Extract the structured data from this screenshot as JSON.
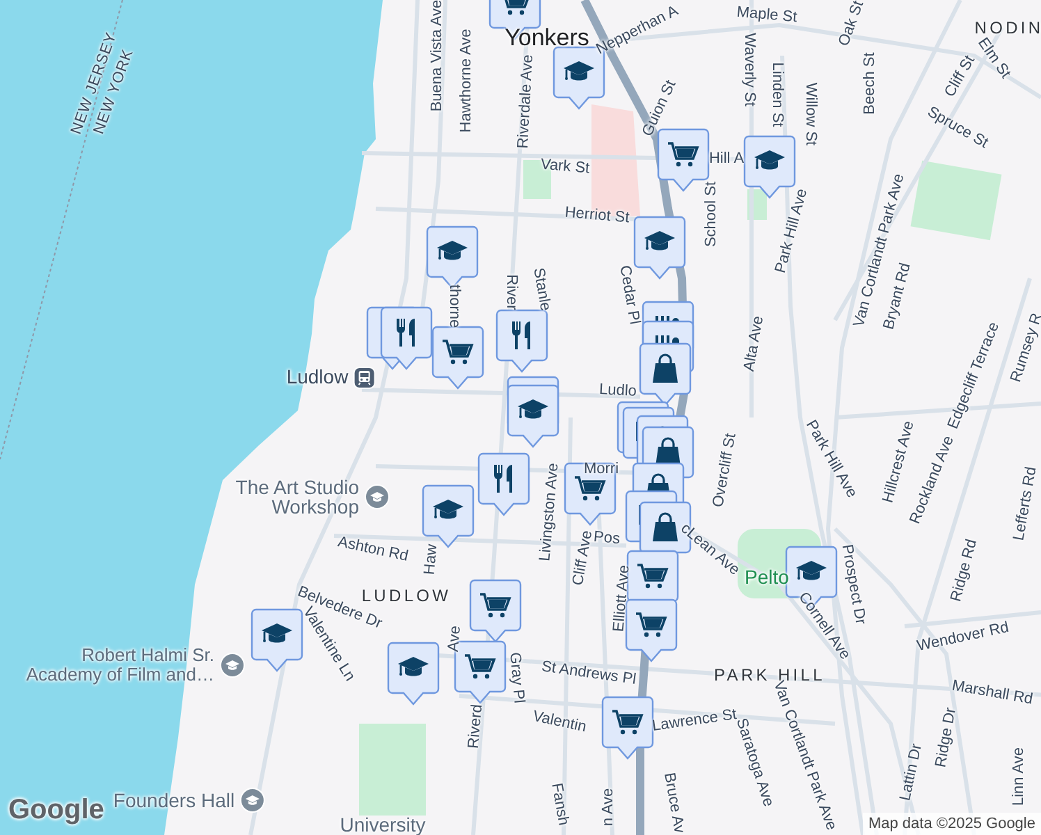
{
  "labels": [
    {
      "text": "NEW JERSEY",
      "kind": "state"
    },
    {
      "text": "NEW YORK",
      "kind": "state"
    },
    {
      "text": "Yonkers",
      "kind": "city"
    },
    {
      "text": "Buena Vista Ave",
      "kind": "street"
    },
    {
      "text": "Hawthorne Ave",
      "kind": "street"
    },
    {
      "text": "Riverdale Ave",
      "kind": "street"
    },
    {
      "text": "Nepperhan A",
      "kind": "street"
    },
    {
      "text": "Maple St",
      "kind": "street"
    },
    {
      "text": "Oak St",
      "kind": "street"
    },
    {
      "text": "NODIN",
      "kind": "neighborhood"
    },
    {
      "text": "Elm St",
      "kind": "street"
    },
    {
      "text": "Cliff St",
      "kind": "street"
    },
    {
      "text": "Spruce St",
      "kind": "street"
    },
    {
      "text": "Beech St",
      "kind": "street"
    },
    {
      "text": "Waverly St",
      "kind": "street"
    },
    {
      "text": "Linden St",
      "kind": "street"
    },
    {
      "text": "Willow St",
      "kind": "street"
    },
    {
      "text": "Guion St",
      "kind": "street"
    },
    {
      "text": "Vark St",
      "kind": "street"
    },
    {
      "text": "Hill A",
      "kind": "street"
    },
    {
      "text": "Herriot St",
      "kind": "street"
    },
    {
      "text": "School St",
      "kind": "street"
    },
    {
      "text": "Park Hill Ave",
      "kind": "street"
    },
    {
      "text": "Van Cortlandt Park Ave",
      "kind": "street"
    },
    {
      "text": "Bryant Rd",
      "kind": "street"
    },
    {
      "text": "Cedar Pl",
      "kind": "street"
    },
    {
      "text": "Stanle",
      "kind": "street"
    },
    {
      "text": "River",
      "kind": "street"
    },
    {
      "text": "thorne",
      "kind": "street"
    },
    {
      "text": "Alta Ave",
      "kind": "street"
    },
    {
      "text": "Ludlo",
      "kind": "street"
    },
    {
      "text": "Ludlow",
      "kind": "station"
    },
    {
      "text": "Edgecliff Terrace",
      "kind": "street"
    },
    {
      "text": "Rumsey R",
      "kind": "street"
    },
    {
      "text": "Overcliff St",
      "kind": "street"
    },
    {
      "text": "Park Hill Ave",
      "kind": "street"
    },
    {
      "text": "Hillcrest Ave",
      "kind": "street"
    },
    {
      "text": "Rockland Ave",
      "kind": "street"
    },
    {
      "text": "Lefferts Rd",
      "kind": "street"
    },
    {
      "text": "Morri",
      "kind": "street"
    },
    {
      "text": "The Art Studio Workshop",
      "kind": "poi"
    },
    {
      "text": "Ashton Rd",
      "kind": "street"
    },
    {
      "text": "Haw",
      "kind": "street"
    },
    {
      "text": "LUDLOW",
      "kind": "neighborhood"
    },
    {
      "text": "Belvedere Dr",
      "kind": "street"
    },
    {
      "text": "Valentine Ln",
      "kind": "street"
    },
    {
      "text": "Robert Halmi Sr. Academy of Film and…",
      "kind": "poi"
    },
    {
      "text": "Ave",
      "kind": "street"
    },
    {
      "text": "Gray Pl",
      "kind": "street"
    },
    {
      "text": "Riverd",
      "kind": "street"
    },
    {
      "text": "Livingston Ave",
      "kind": "street"
    },
    {
      "text": "Cliff Ave",
      "kind": "street"
    },
    {
      "text": "Elliott Ave",
      "kind": "street"
    },
    {
      "text": "Pos",
      "kind": "street"
    },
    {
      "text": "cLean Ave",
      "kind": "street"
    },
    {
      "text": "Pelto",
      "kind": "park"
    },
    {
      "text": "Prospect Dr",
      "kind": "street"
    },
    {
      "text": "Ridge Rd",
      "kind": "street"
    },
    {
      "text": "Wendover Rd",
      "kind": "street"
    },
    {
      "text": "Cornell Ave",
      "kind": "street"
    },
    {
      "text": "PARK HILL",
      "kind": "neighborhood"
    },
    {
      "text": "Marshall Rd",
      "kind": "street"
    },
    {
      "text": "St Andrews Pl",
      "kind": "street"
    },
    {
      "text": "Valentin",
      "kind": "street"
    },
    {
      "text": "Lawrence St",
      "kind": "street"
    },
    {
      "text": "Van Cortlandt Park Ave",
      "kind": "street"
    },
    {
      "text": "Saratoga Ave",
      "kind": "street"
    },
    {
      "text": "Bruce Av",
      "kind": "street"
    },
    {
      "text": "Lattin Dr",
      "kind": "street"
    },
    {
      "text": "Ridge Dr",
      "kind": "street"
    },
    {
      "text": "Linn Ave",
      "kind": "street"
    },
    {
      "text": "Fansh",
      "kind": "street"
    },
    {
      "text": "n Ave",
      "kind": "street"
    },
    {
      "text": "Founders Hall",
      "kind": "poi"
    },
    {
      "text": "University",
      "kind": "poi_partial"
    }
  ],
  "markers": [
    {
      "kind": "cart"
    },
    {
      "kind": "school"
    },
    {
      "kind": "cart"
    },
    {
      "kind": "school"
    },
    {
      "kind": "school"
    },
    {
      "kind": "school"
    },
    {
      "kind": "restaurant"
    },
    {
      "kind": "restaurant"
    },
    {
      "kind": "cart"
    },
    {
      "kind": "restaurant"
    },
    {
      "kind": "store"
    },
    {
      "kind": "store"
    },
    {
      "kind": "bag"
    },
    {
      "kind": "school"
    },
    {
      "kind": "school"
    },
    {
      "kind": "store"
    },
    {
      "kind": "store"
    },
    {
      "kind": "bag"
    },
    {
      "kind": "bag"
    },
    {
      "kind": "cart"
    },
    {
      "kind": "restaurant"
    },
    {
      "kind": "school"
    },
    {
      "kind": "bag"
    },
    {
      "kind": "store"
    },
    {
      "kind": "bag"
    },
    {
      "kind": "cart"
    },
    {
      "kind": "cart"
    },
    {
      "kind": "school"
    },
    {
      "kind": "cart"
    },
    {
      "kind": "cart"
    },
    {
      "kind": "school"
    },
    {
      "kind": "school"
    },
    {
      "kind": "cart"
    }
  ],
  "logo": "Google",
  "attribution": "Map data ©2025 Google"
}
